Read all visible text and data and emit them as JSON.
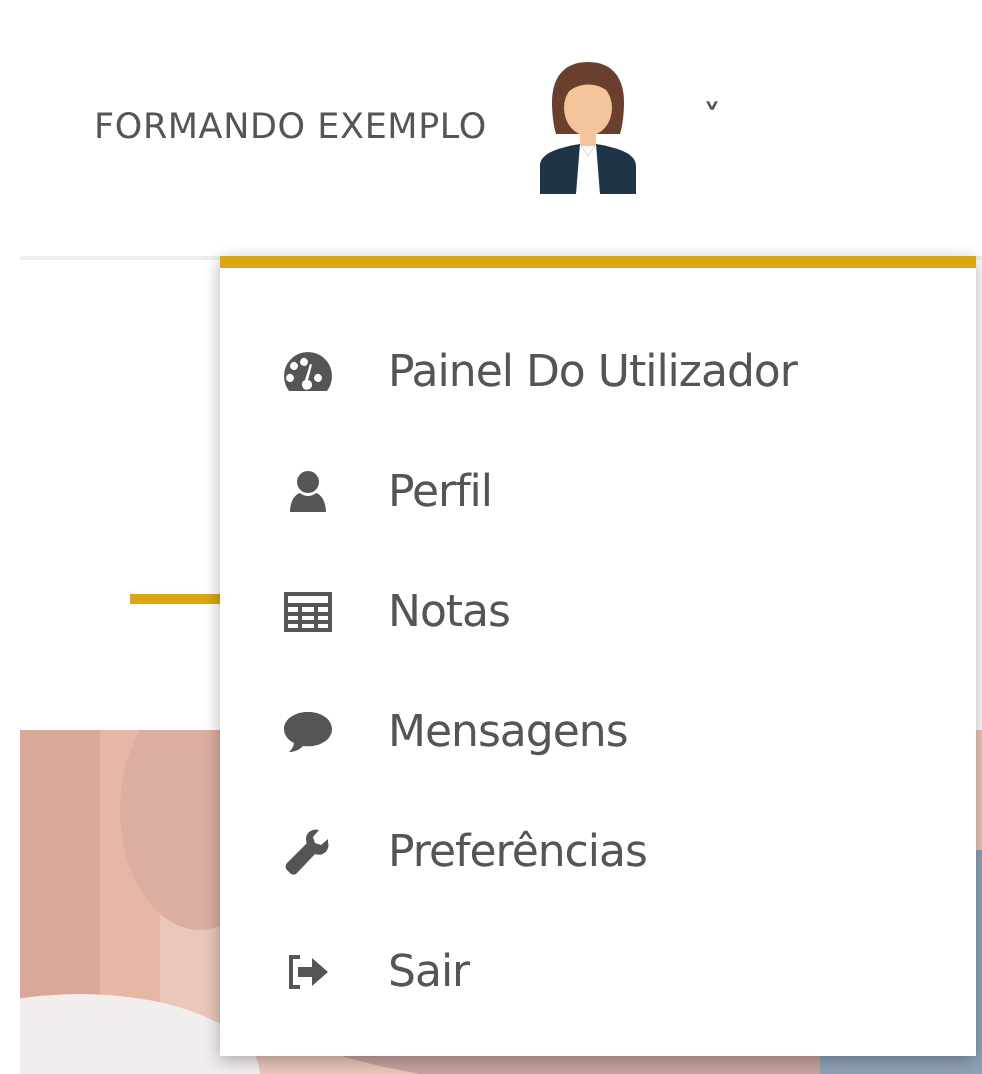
{
  "header": {
    "user_name": "FORMANDO EXEMPLO",
    "caret": "˅"
  },
  "user_menu": {
    "items": [
      {
        "label": "Painel Do Utilizador"
      },
      {
        "label": "Perfil"
      },
      {
        "label": "Notas"
      },
      {
        "label": "Mensagens"
      },
      {
        "label": "Preferências"
      },
      {
        "label": "Sair"
      }
    ]
  }
}
